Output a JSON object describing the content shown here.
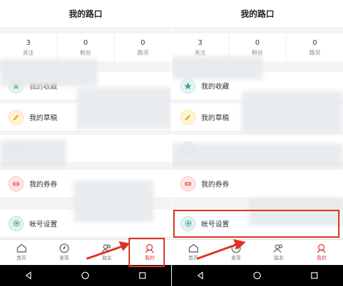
{
  "screens": [
    {
      "title": "我的路口",
      "stats": [
        {
          "value": "3",
          "label": "关注"
        },
        {
          "value": "0",
          "label": "粉丝"
        },
        {
          "value": "0",
          "label": "路况"
        }
      ],
      "menu": [
        {
          "label": "我的收藏",
          "icon": "star-icon"
        },
        {
          "label": "我的草稿",
          "icon": "pencil-icon"
        },
        {
          "label": "我的券券",
          "icon": "ticket-icon"
        },
        {
          "label": "帐号设置",
          "icon": "gear-icon"
        }
      ],
      "tabs": [
        {
          "label": "首页",
          "icon": "home-icon"
        },
        {
          "label": "发现",
          "icon": "compass-icon"
        },
        {
          "label": "路友",
          "icon": "friends-icon"
        },
        {
          "label": "我的",
          "icon": "profile-icon",
          "active": true
        }
      ]
    },
    {
      "title": "我的路口",
      "stats": [
        {
          "value": "3",
          "label": "关注"
        },
        {
          "value": "0",
          "label": "粉丝"
        },
        {
          "value": "0",
          "label": "路况"
        }
      ],
      "menu": [
        {
          "label": "我的收藏",
          "icon": "star-icon"
        },
        {
          "label": "我的草稿",
          "icon": "pencil-icon"
        },
        {
          "label": "我的券券",
          "icon": "ticket-icon"
        },
        {
          "label": "帐号设置",
          "icon": "gear-icon"
        }
      ],
      "tabs": [
        {
          "label": "首页",
          "icon": "home-icon"
        },
        {
          "label": "发现",
          "icon": "compass-icon"
        },
        {
          "label": "路友",
          "icon": "friends-icon"
        },
        {
          "label": "我的",
          "icon": "profile-icon",
          "active": true
        }
      ]
    }
  ],
  "colors": {
    "accent": "#e4393c",
    "highlight": "#e0321e",
    "teal": "#3aa89a",
    "yellow": "#f0b52b",
    "coral": "#e8776b"
  }
}
